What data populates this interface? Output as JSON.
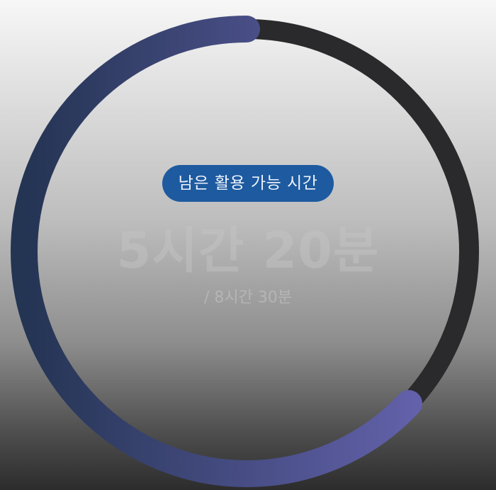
{
  "timer": {
    "label": "남은 활용 가능 시간",
    "remaining": "5시간 20분",
    "total": "/ 8시간 30분",
    "progress_fraction": 0.63
  },
  "colors": {
    "track": "#2a2a2c",
    "progress_start": "#6b67b6",
    "progress_end": "#243453",
    "pill_background": "#1d5aa0",
    "pill_text": "#eef3fa"
  }
}
